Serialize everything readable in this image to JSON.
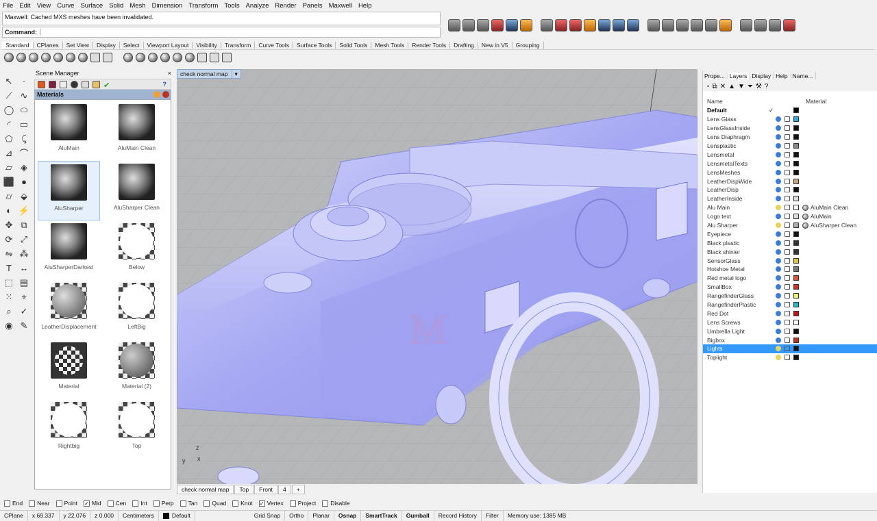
{
  "menu": [
    "File",
    "Edit",
    "View",
    "Curve",
    "Surface",
    "Solid",
    "Mesh",
    "Dimension",
    "Transform",
    "Tools",
    "Analyze",
    "Render",
    "Panels",
    "Maxwell",
    "Help"
  ],
  "command_history": "Maxwell: Cached MXS meshes have been invalidated.",
  "command_label": "Command:",
  "toolbar_tabs": [
    "Standard",
    "CPlanes",
    "Set View",
    "Display",
    "Select",
    "Viewport Layout",
    "Visibility",
    "Transform",
    "Curve Tools",
    "Surface Tools",
    "Solid Tools",
    "Mesh Tools",
    "Render Tools",
    "Drafting",
    "New in V5",
    "Grouping"
  ],
  "scene_manager": {
    "title": "Scene Manager",
    "help": "?",
    "header": "Materials",
    "materials": [
      {
        "name": "AluMain",
        "thumb": "metal"
      },
      {
        "name": "AluMain Clean",
        "thumb": "metal"
      },
      {
        "name": "AluSharper",
        "thumb": "metal"
      },
      {
        "name": "AluSharper Clean",
        "thumb": "metal"
      },
      {
        "name": "AluSharperDarkest",
        "thumb": "metal"
      },
      {
        "name": "Below",
        "thumb": "white"
      },
      {
        "name": "LeatherDisplacement",
        "thumb": "leather"
      },
      {
        "name": "LeftBig",
        "thumb": "white"
      },
      {
        "name": "Material",
        "thumb": "check"
      },
      {
        "name": "Material (2)",
        "thumb": "grey"
      },
      {
        "name": "Rightbig",
        "thumb": "white"
      },
      {
        "name": "Top",
        "thumb": "white"
      }
    ],
    "selected": "AluSharper"
  },
  "viewport": {
    "title": "check normal map",
    "tabs": [
      "check normal map",
      "Top",
      "Front",
      "4",
      "+"
    ],
    "model_letter": "M"
  },
  "right_panel": {
    "tabs": [
      "Prope...",
      "Layers",
      "Display",
      "Help",
      "Name..."
    ],
    "col_name": "Name",
    "col_material": "Material",
    "layers": [
      {
        "name": "Default",
        "current": true,
        "color": "#000000",
        "material": "",
        "bulb": "on"
      },
      {
        "name": "Lens Glass",
        "color": "#2aa8e0",
        "material": "",
        "bulb": "on"
      },
      {
        "name": "LensGlassInside",
        "color": "#111111",
        "material": "",
        "bulb": "on"
      },
      {
        "name": "Lens Diaphragm",
        "color": "#111111",
        "material": "",
        "bulb": "on"
      },
      {
        "name": "Lensplastic",
        "color": "#888888",
        "material": "",
        "bulb": "on"
      },
      {
        "name": "Lensmetal",
        "color": "#111111",
        "material": "",
        "bulb": "on"
      },
      {
        "name": "LensmetalTexts",
        "color": "#111111",
        "material": "",
        "bulb": "on"
      },
      {
        "name": "LensMeshes",
        "color": "#111111",
        "material": "",
        "bulb": "on"
      },
      {
        "name": "LeatherDispWide",
        "color": "#c8a27a",
        "material": "",
        "bulb": "on"
      },
      {
        "name": "LeatherDisp",
        "color": "#111111",
        "material": "",
        "bulb": "on"
      },
      {
        "name": "LeatherInside",
        "color": "#dddddd",
        "material": "",
        "bulb": "on"
      },
      {
        "name": "Alu Main",
        "color": "#ffffff",
        "material": "AluMain Clean",
        "bulb": "off"
      },
      {
        "name": "Logo text",
        "color": "#dddddd",
        "material": "AluMain",
        "bulb": "on"
      },
      {
        "name": "Alu Sharper",
        "color": "#aaaaaa",
        "material": "AluSharper Clean",
        "bulb": "off"
      },
      {
        "name": "Eyepiece",
        "color": "#111111",
        "material": "",
        "bulb": "on"
      },
      {
        "name": "Black plastic",
        "color": "#333333",
        "material": "",
        "bulb": "on"
      },
      {
        "name": "Black shinier",
        "color": "#333333",
        "material": "",
        "bulb": "on"
      },
      {
        "name": "SensorGlass",
        "color": "#e8c040",
        "material": "",
        "bulb": "on"
      },
      {
        "name": "Hotshoe Metal",
        "color": "#777777",
        "material": "",
        "bulb": "on"
      },
      {
        "name": "Red metal logo",
        "color": "#e05030",
        "material": "",
        "bulb": "on"
      },
      {
        "name": "SmallBox",
        "color": "#d03020",
        "material": "",
        "bulb": "on"
      },
      {
        "name": "RangefinderGlass",
        "color": "#e8f070",
        "material": "",
        "bulb": "on"
      },
      {
        "name": "RangefinderPlastic",
        "color": "#20b8c8",
        "material": "",
        "bulb": "on"
      },
      {
        "name": "Red Dot",
        "color": "#c01818",
        "material": "",
        "bulb": "on"
      },
      {
        "name": "Lens Screws",
        "color": "#ffffff",
        "material": "",
        "bulb": "on"
      },
      {
        "name": "Umbrella Light",
        "color": "#111111",
        "material": "",
        "bulb": "on"
      },
      {
        "name": "Bigbox",
        "color": "#c03020",
        "material": "",
        "bulb": "on"
      },
      {
        "name": "Lights",
        "color": "#111111",
        "material": "",
        "bulb": "off",
        "selected": true
      },
      {
        "name": "Toplight",
        "color": "#111111",
        "material": "",
        "bulb": "off"
      }
    ]
  },
  "osnap": [
    {
      "label": "End",
      "checked": false
    },
    {
      "label": "Near",
      "checked": false
    },
    {
      "label": "Point",
      "checked": false
    },
    {
      "label": "Mid",
      "checked": true
    },
    {
      "label": "Cen",
      "checked": false
    },
    {
      "label": "Int",
      "checked": false
    },
    {
      "label": "Perp",
      "checked": false
    },
    {
      "label": "Tan",
      "checked": false
    },
    {
      "label": "Quad",
      "checked": false
    },
    {
      "label": "Knot",
      "checked": false
    },
    {
      "label": "Vertex",
      "checked": true
    },
    {
      "label": "Project",
      "checked": false
    },
    {
      "label": "Disable",
      "checked": false
    }
  ],
  "status": {
    "cplane": "CPlane",
    "x": "x 69.337",
    "y": "y 22.076",
    "z": "z 0.000",
    "units": "Centimeters",
    "layer": "Default",
    "grid_snap": "Grid Snap",
    "ortho": "Ortho",
    "planar": "Planar",
    "osnap": "Osnap",
    "smarttrack": "SmartTrack",
    "gumball": "Gumball",
    "record_history": "Record History",
    "filter": "Filter",
    "memory": "Memory use: 1385 MB"
  },
  "colors": {
    "model": "#a5a8f5",
    "viewport_bg": "#b6b7b9",
    "select": "#3399ff"
  }
}
